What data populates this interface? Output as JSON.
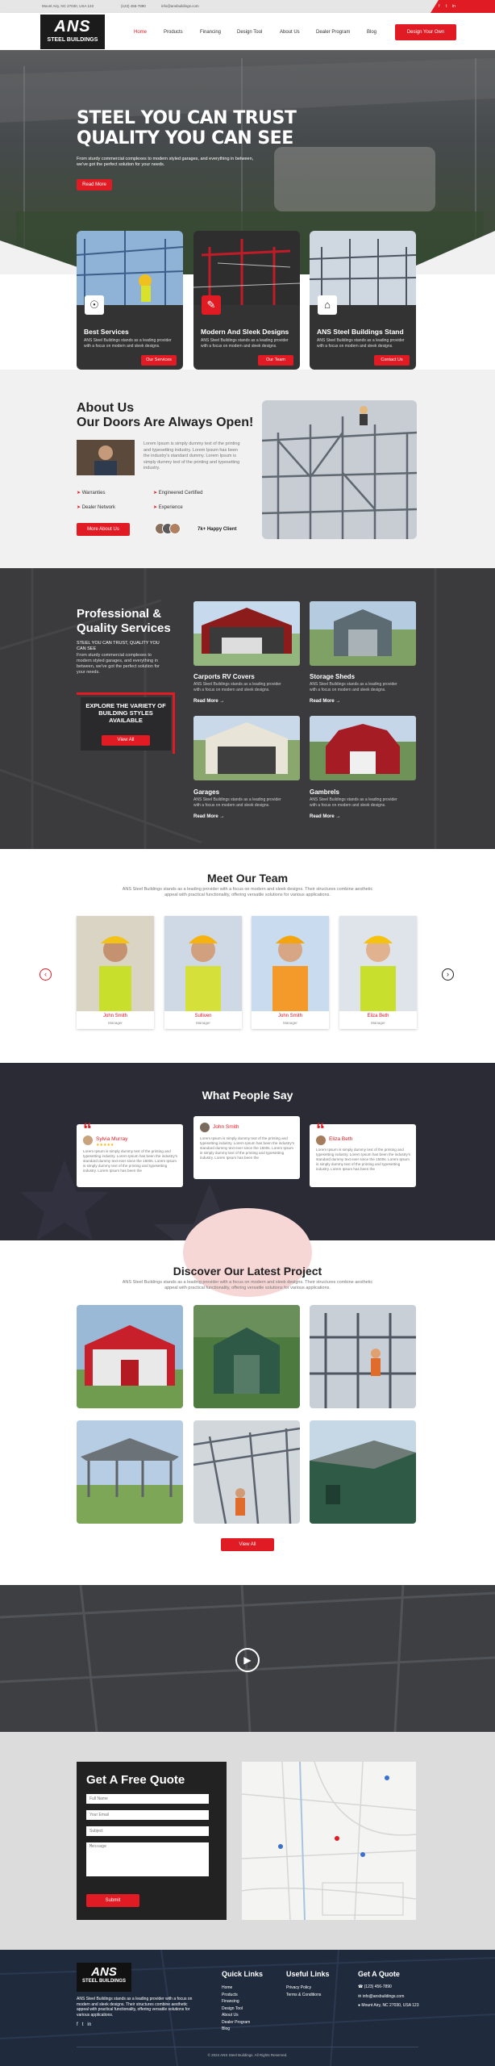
{
  "topbar": {
    "address": "Mount Airy, NC 27030, USA 123",
    "phone": "(123) 456-7890",
    "email": "info@ansbuildings.com",
    "social": [
      "f",
      "t",
      "in"
    ]
  },
  "header": {
    "logo_big": "ANS",
    "logo_small": "STEEL BUILDINGS",
    "nav": [
      "Home",
      "Products",
      "Financing",
      "Design Tool",
      "About Us",
      "Dealer Program",
      "Blog"
    ],
    "cta": "Design Your Own"
  },
  "hero": {
    "title_line1": "STEEL YOU CAN TRUST",
    "title_line2": "QUALITY YOU CAN SEE",
    "text": "From sturdy commercial complexes to modern styled garages, and everything in between, we've got the perfect solution for your needs.",
    "button": "Read More"
  },
  "services": [
    {
      "title": "Best Services",
      "text": "ANS Steel Buildings stands as a leading provider with a focus on modern and sleek designs.",
      "button": "Our Services"
    },
    {
      "title": "Modern And Sleek Designs",
      "text": "ANS Steel Buildings stands as a leading provider with a focus on modern and sleek designs.",
      "button": "Our Team"
    },
    {
      "title": "ANS Steel Buildings Stand",
      "text": "ANS Steel Buildings stands as a leading provider with a focus on modern and sleek designs.",
      "button": "Contact Us"
    }
  ],
  "about": {
    "title_line1": "About Us",
    "title_line2": "Our Doors Are Always Open!",
    "text": "Lorem Ipsum is simply dummy text of the printing and typesetting industry. Lorem Ipsum has been the industry's standard dummy. Lorem Ipsum is simply dummy text of the printing and typesetting industry.",
    "features": [
      "Warranties",
      "Engineered Certified",
      "Dealer Network",
      "Experience"
    ],
    "button": "More About Us",
    "clients": "7k+ Happy Client"
  },
  "quality": {
    "title_line1": "Professional &",
    "title_line2": "Quality Services",
    "kicker": "STEEL YOU CAN TRUST, QUALITY YOU CAN SEE",
    "text": "From sturdy commercial complexes to modern styled garages, and everything in between, we've got the perfect solution for your needs.",
    "explore": "EXPLORE THE VARIETY OF BUILDING STYLES AVAILABLE",
    "explore_button": "View All",
    "items": [
      {
        "title": "Carports RV Covers",
        "text": "ANS Steel Buildings stands as a leading provider with a focus on modern and sleek designs.",
        "link": "Read More"
      },
      {
        "title": "Storage Sheds",
        "text": "ANS Steel Buildings stands as a leading provider with a focus on modern and sleek designs.",
        "link": "Read More"
      },
      {
        "title": "Garages",
        "text": "ANS Steel Buildings stands as a leading provider with a focus on modern and sleek designs.",
        "link": "Read More"
      },
      {
        "title": "Gambrels",
        "text": "ANS Steel Buildings stands as a leading provider with a focus on modern and sleek designs.",
        "link": "Read More"
      }
    ]
  },
  "team": {
    "title": "Meet Our Team",
    "sub": "ANS Steel Buildings stands as a leading provider with a focus on modern and sleek designs. Their structures combine aesthetic appeal with practical functionality, offering versatile solutions for various applications.",
    "members": [
      {
        "name": "John Smith",
        "role": "Manager"
      },
      {
        "name": "Sulliven",
        "role": "Manager"
      },
      {
        "name": "John Smith",
        "role": "Manager"
      },
      {
        "name": "Eliza Beth",
        "role": "Manager"
      }
    ]
  },
  "testimonials": {
    "title": "What People Say",
    "items": [
      {
        "name": "Sylvia Murray",
        "text": "Lorem Ipsum is simply dummy text of the printing and typesetting industry. Lorem Ipsum has been the industry's standard dummy text ever since the 1500s. Lorem Ipsum is simply dummy text of the printing and typesetting industry. Lorem Ipsum has been the"
      },
      {
        "name": "John Smith",
        "text": "Lorem Ipsum is simply dummy text of the printing and typesetting industry. Lorem Ipsum has been the industry's standard dummy text ever since the 1500s. Lorem Ipsum is simply dummy text of the printing and typesetting industry. Lorem Ipsum has been the"
      },
      {
        "name": "Eliza Beth",
        "text": "Lorem Ipsum is simply dummy text of the printing and typesetting industry. Lorem Ipsum has been the industry's standard dummy text ever since the 1500s. Lorem Ipsum is simply dummy text of the printing and typesetting industry. Lorem Ipsum has been the"
      }
    ]
  },
  "projects": {
    "title": "Discover Our Latest Project",
    "sub": "ANS Steel Buildings stands as a leading provider with a focus on modern and sleek designs. Their structures combine aesthetic appeal with practical functionality, offering versatile solutions for various applications.",
    "button": "View All"
  },
  "quote": {
    "title": "Get A Free Quote",
    "fields": [
      "Full Name",
      "Your Email",
      "Subject",
      "Message"
    ],
    "button": "Submit"
  },
  "footer": {
    "about": "ANS Steel Buildings stands as a leading provider with a focus on modern and sleek designs. Their structures combine aesthetic appeal with practical functionality, offering versatile solutions for various applications.",
    "quick_title": "Quick Links",
    "quick": [
      "Home",
      "Products",
      "Financing",
      "Design Tool",
      "About Us",
      "Dealer Program",
      "Blog"
    ],
    "useful_title": "Useful Links",
    "useful": [
      "Privacy Policy",
      "Terms & Conditions"
    ],
    "quote_title": "Get A Quote",
    "contact": [
      "(123) 456-7890",
      "info@ansbuildings.com",
      "Mount Airy, NC 27030, USA 123"
    ],
    "copyright": "© 2024 ANS Steel Buildings. All Rights Reserved."
  },
  "colors": {
    "accent": "#e01b24",
    "dark": "#2b2b36"
  }
}
